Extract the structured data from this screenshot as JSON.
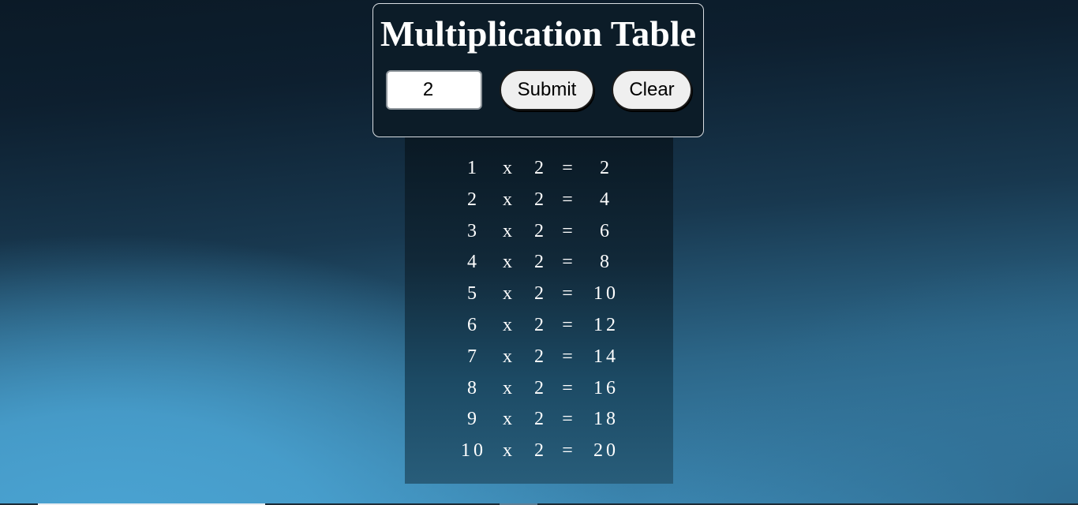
{
  "header": {
    "title": "Multiplication Table",
    "number_value": "2",
    "submit_label": "Submit",
    "clear_label": "Clear"
  },
  "table": {
    "times_symbol": "x",
    "equals_symbol": "=",
    "rows": [
      {
        "n": "1",
        "m": "2",
        "result": "2"
      },
      {
        "n": "2",
        "m": "2",
        "result": "4"
      },
      {
        "n": "3",
        "m": "2",
        "result": "6"
      },
      {
        "n": "4",
        "m": "2",
        "result": "8"
      },
      {
        "n": "5",
        "m": "2",
        "result": "10"
      },
      {
        "n": "6",
        "m": "2",
        "result": "12"
      },
      {
        "n": "7",
        "m": "2",
        "result": "14"
      },
      {
        "n": "8",
        "m": "2",
        "result": "16"
      },
      {
        "n": "9",
        "m": "2",
        "result": "18"
      },
      {
        "n": "10",
        "m": "2",
        "result": "20"
      }
    ]
  },
  "colors": {
    "panel_border": "#d8dde2",
    "text": "#ffffff",
    "button_bg": "#efefef"
  }
}
